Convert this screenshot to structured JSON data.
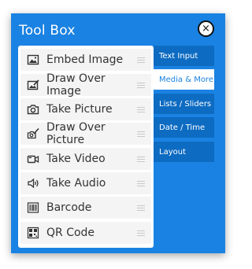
{
  "window": {
    "title": "Tool Box",
    "close_label": "×"
  },
  "items": [
    {
      "label": "Embed Image",
      "icon": "image-icon"
    },
    {
      "label": "Draw Over Image",
      "icon": "draw-over-image-icon"
    },
    {
      "label": "Take Picture",
      "icon": "camera-icon"
    },
    {
      "label": "Draw Over Picture",
      "icon": "draw-over-picture-icon"
    },
    {
      "label": "Take Video",
      "icon": "video-camera-icon"
    },
    {
      "label": "Take Audio",
      "icon": "speaker-icon"
    },
    {
      "label": "Barcode",
      "icon": "barcode-icon"
    },
    {
      "label": "QR Code",
      "icon": "qr-code-icon"
    }
  ],
  "tabs": [
    {
      "label": "Text Input",
      "active": false
    },
    {
      "label": "Media & More",
      "active": true
    },
    {
      "label": "Lists / Sliders",
      "active": false
    },
    {
      "label": "Date / Time",
      "active": false
    },
    {
      "label": "Layout",
      "active": false
    }
  ],
  "colors": {
    "panel": "#1a82e2",
    "tab_inactive": "#0d6bc2",
    "tab_active_bg": "#ffffff",
    "tab_active_text": "#1a82e2"
  }
}
